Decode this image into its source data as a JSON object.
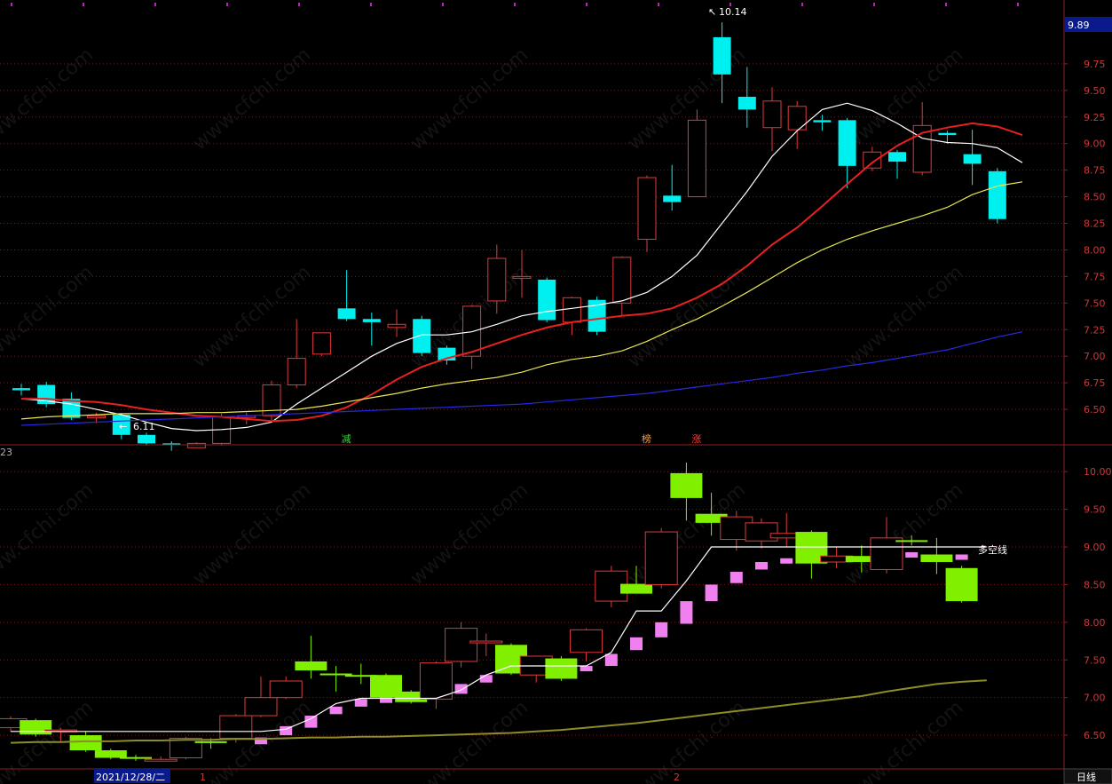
{
  "chart_data": [
    {
      "type": "candlestick",
      "panel": "top",
      "ylim": [
        6.2,
        10.25
      ],
      "yticks": [
        6.5,
        6.75,
        7.0,
        7.25,
        7.5,
        7.75,
        8.0,
        8.25,
        8.5,
        8.75,
        9.0,
        9.25,
        9.5,
        9.75
      ],
      "current_price_label": "9.89",
      "high_label": "10.14",
      "low_label": "6.11",
      "marker_labels": [
        {
          "text": "减",
          "index": 13,
          "color": "#3cd23c"
        },
        {
          "text": "榜",
          "index": 25,
          "color": "#e8a050"
        },
        {
          "text": "涨",
          "index": 27,
          "color": "#ff3c3c"
        }
      ],
      "left_axis_stub": "23",
      "candles": [
        {
          "o": 6.7,
          "h": 6.74,
          "l": 6.63,
          "c": 6.68
        },
        {
          "o": 6.73,
          "h": 6.76,
          "l": 6.52,
          "c": 6.55
        },
        {
          "o": 6.6,
          "h": 6.66,
          "l": 6.4,
          "c": 6.42
        },
        {
          "o": 6.42,
          "h": 6.47,
          "l": 6.37,
          "c": 6.44
        },
        {
          "o": 6.45,
          "h": 6.46,
          "l": 6.22,
          "c": 6.26
        },
        {
          "o": 6.26,
          "h": 6.28,
          "l": 6.16,
          "c": 6.18
        },
        {
          "o": 6.18,
          "h": 6.2,
          "l": 6.11,
          "c": 6.17
        },
        {
          "o": 6.14,
          "h": 6.19,
          "l": 6.14,
          "c": 6.18
        },
        {
          "o": 6.18,
          "h": 6.46,
          "l": 6.16,
          "c": 6.43
        },
        {
          "o": 6.44,
          "h": 6.47,
          "l": 6.36,
          "c": 6.44
        },
        {
          "o": 6.44,
          "h": 6.77,
          "l": 6.4,
          "c": 6.73
        },
        {
          "o": 6.73,
          "h": 7.35,
          "l": 6.7,
          "c": 6.98
        },
        {
          "o": 7.02,
          "h": 7.22,
          "l": 7.0,
          "c": 7.22
        },
        {
          "o": 7.45,
          "h": 7.81,
          "l": 7.33,
          "c": 7.35
        },
        {
          "o": 7.35,
          "h": 7.41,
          "l": 7.1,
          "c": 7.32
        },
        {
          "o": 7.27,
          "h": 7.44,
          "l": 7.18,
          "c": 7.3
        },
        {
          "o": 7.35,
          "h": 7.38,
          "l": 7.0,
          "c": 7.03
        },
        {
          "o": 7.08,
          "h": 7.1,
          "l": 6.92,
          "c": 6.96
        },
        {
          "o": 7.0,
          "h": 7.48,
          "l": 6.88,
          "c": 7.47
        },
        {
          "o": 7.52,
          "h": 8.05,
          "l": 7.4,
          "c": 7.92
        },
        {
          "o": 7.75,
          "h": 8.0,
          "l": 7.55,
          "c": 7.75
        },
        {
          "o": 7.72,
          "h": 7.74,
          "l": 7.32,
          "c": 7.34
        },
        {
          "o": 7.32,
          "h": 7.56,
          "l": 7.2,
          "c": 7.55
        },
        {
          "o": 7.53,
          "h": 7.56,
          "l": 7.2,
          "c": 7.23
        },
        {
          "o": 7.5,
          "h": 7.94,
          "l": 7.38,
          "c": 7.93
        },
        {
          "o": 8.1,
          "h": 8.7,
          "l": 7.98,
          "c": 8.68
        },
        {
          "o": 8.51,
          "h": 8.8,
          "l": 8.37,
          "c": 8.45
        },
        {
          "o": 8.5,
          "h": 9.32,
          "l": 8.5,
          "c": 9.22
        },
        {
          "o": 10.0,
          "h": 10.14,
          "l": 9.38,
          "c": 9.65
        },
        {
          "o": 9.44,
          "h": 9.72,
          "l": 9.15,
          "c": 9.32
        },
        {
          "o": 9.15,
          "h": 9.53,
          "l": 8.93,
          "c": 9.4
        },
        {
          "o": 9.13,
          "h": 9.4,
          "l": 8.95,
          "c": 9.35
        },
        {
          "o": 9.22,
          "h": 9.27,
          "l": 9.12,
          "c": 9.2
        },
        {
          "o": 9.22,
          "h": 9.24,
          "l": 8.58,
          "c": 8.79
        },
        {
          "o": 8.77,
          "h": 8.97,
          "l": 8.74,
          "c": 8.92
        },
        {
          "o": 8.92,
          "h": 8.94,
          "l": 8.67,
          "c": 8.83
        },
        {
          "o": 8.73,
          "h": 9.39,
          "l": 8.7,
          "c": 9.17
        },
        {
          "o": 9.1,
          "h": 9.12,
          "l": 9.0,
          "c": 9.08
        },
        {
          "o": 8.9,
          "h": 9.13,
          "l": 8.61,
          "c": 8.81
        },
        {
          "o": 8.74,
          "h": 8.77,
          "l": 8.25,
          "c": 8.29
        }
      ],
      "series": [
        {
          "color": "#ffffff",
          "values": [
            6.6,
            6.58,
            6.55,
            6.5,
            6.45,
            6.38,
            6.32,
            6.3,
            6.31,
            6.33,
            6.38,
            6.55,
            6.7,
            6.85,
            7.0,
            7.12,
            7.2,
            7.2,
            7.23,
            7.3,
            7.38,
            7.42,
            7.45,
            7.48,
            7.52,
            7.6,
            7.75,
            7.95,
            8.25,
            8.55,
            8.88,
            9.12,
            9.32,
            9.38,
            9.31,
            9.19,
            9.05,
            9.01,
            9.0,
            8.96,
            8.82
          ]
        },
        {
          "color": "#e82020",
          "values": [
            6.6,
            6.6,
            6.58,
            6.57,
            6.54,
            6.5,
            6.47,
            6.44,
            6.43,
            6.41,
            6.39,
            6.4,
            6.44,
            6.52,
            6.64,
            6.78,
            6.9,
            6.98,
            7.04,
            7.12,
            7.2,
            7.27,
            7.32,
            7.35,
            7.38,
            7.4,
            7.45,
            7.55,
            7.68,
            7.85,
            8.05,
            8.21,
            8.41,
            8.62,
            8.82,
            8.98,
            9.1,
            9.15,
            9.19,
            9.16,
            9.08
          ]
        },
        {
          "color": "#e8e850",
          "values": [
            6.41,
            6.43,
            6.44,
            6.45,
            6.46,
            6.46,
            6.46,
            6.47,
            6.47,
            6.48,
            6.49,
            6.5,
            6.53,
            6.57,
            6.61,
            6.65,
            6.7,
            6.74,
            6.77,
            6.8,
            6.85,
            6.92,
            6.97,
            7.0,
            7.05,
            7.14,
            7.25,
            7.35,
            7.47,
            7.6,
            7.74,
            7.88,
            8.0,
            8.1,
            8.18,
            8.25,
            8.32,
            8.4,
            8.52,
            8.6,
            8.64
          ]
        },
        {
          "color": "#2828e0",
          "values": [
            6.35,
            6.36,
            6.37,
            6.38,
            6.39,
            6.4,
            6.41,
            6.42,
            6.43,
            6.44,
            6.45,
            6.46,
            6.47,
            6.48,
            6.49,
            6.5,
            6.51,
            6.52,
            6.53,
            6.54,
            6.55,
            6.57,
            6.59,
            6.61,
            6.63,
            6.65,
            6.68,
            6.71,
            6.74,
            6.77,
            6.8,
            6.84,
            6.87,
            6.91,
            6.94,
            6.98,
            7.02,
            7.06,
            7.12,
            7.18,
            7.23
          ]
        }
      ]
    },
    {
      "type": "candlestick",
      "panel": "bottom",
      "ylim": [
        6.1,
        10.25
      ],
      "yticks": [
        6.5,
        7.0,
        7.5,
        8.0,
        8.5,
        9.0,
        9.5,
        10.0
      ],
      "line_label": "多空线",
      "candles": [
        {
          "o": 6.6,
          "h": 6.75,
          "l": 6.55,
          "c": 6.72
        },
        {
          "o": 6.7,
          "h": 6.72,
          "l": 6.48,
          "c": 6.51
        },
        {
          "o": 6.55,
          "h": 6.6,
          "l": 6.4,
          "c": 6.57
        },
        {
          "o": 6.5,
          "h": 6.55,
          "l": 6.28,
          "c": 6.3
        },
        {
          "o": 6.3,
          "h": 6.32,
          "l": 6.18,
          "c": 6.2
        },
        {
          "o": 6.21,
          "h": 6.24,
          "l": 6.16,
          "c": 6.19
        },
        {
          "o": 6.17,
          "h": 6.22,
          "l": 6.15,
          "c": 6.18
        },
        {
          "o": 6.2,
          "h": 6.48,
          "l": 6.18,
          "c": 6.46
        },
        {
          "o": 6.42,
          "h": 6.46,
          "l": 6.32,
          "c": 6.41
        },
        {
          "o": 6.46,
          "h": 6.78,
          "l": 6.4,
          "c": 6.76
        },
        {
          "o": 6.76,
          "h": 7.28,
          "l": 6.74,
          "c": 7.0
        },
        {
          "o": 7.0,
          "h": 7.28,
          "l": 6.98,
          "c": 7.22
        },
        {
          "o": 7.48,
          "h": 7.82,
          "l": 7.25,
          "c": 7.36
        },
        {
          "o": 7.32,
          "h": 7.42,
          "l": 7.08,
          "c": 7.3
        },
        {
          "o": 7.3,
          "h": 7.45,
          "l": 7.18,
          "c": 7.28
        },
        {
          "o": 7.3,
          "h": 7.32,
          "l": 6.98,
          "c": 7.0
        },
        {
          "o": 7.08,
          "h": 7.1,
          "l": 6.92,
          "c": 6.94
        },
        {
          "o": 6.98,
          "h": 7.48,
          "l": 6.85,
          "c": 7.46
        },
        {
          "o": 7.48,
          "h": 8.0,
          "l": 7.4,
          "c": 7.92
        },
        {
          "o": 7.75,
          "h": 7.85,
          "l": 7.55,
          "c": 7.75
        },
        {
          "o": 7.7,
          "h": 7.72,
          "l": 7.3,
          "c": 7.32
        },
        {
          "o": 7.3,
          "h": 7.55,
          "l": 7.2,
          "c": 7.55
        },
        {
          "o": 7.52,
          "h": 7.55,
          "l": 7.22,
          "c": 7.25
        },
        {
          "o": 7.6,
          "h": 7.92,
          "l": 7.48,
          "c": 7.9
        },
        {
          "o": 8.28,
          "h": 8.75,
          "l": 8.2,
          "c": 8.68
        },
        {
          "o": 8.51,
          "h": 8.75,
          "l": 8.38,
          "c": 8.38
        },
        {
          "o": 8.5,
          "h": 9.25,
          "l": 8.45,
          "c": 9.2
        },
        {
          "o": 9.98,
          "h": 10.12,
          "l": 9.35,
          "c": 9.65
        },
        {
          "o": 9.44,
          "h": 9.72,
          "l": 9.15,
          "c": 9.32
        },
        {
          "o": 9.1,
          "h": 9.48,
          "l": 8.95,
          "c": 9.4
        },
        {
          "o": 9.08,
          "h": 9.38,
          "l": 8.98,
          "c": 9.32
        },
        {
          "o": 9.12,
          "h": 9.45,
          "l": 9.0,
          "c": 9.18
        },
        {
          "o": 9.2,
          "h": 9.22,
          "l": 8.58,
          "c": 8.78
        },
        {
          "o": 8.8,
          "h": 9.0,
          "l": 8.72,
          "c": 8.88
        },
        {
          "o": 8.88,
          "h": 9.02,
          "l": 8.66,
          "c": 8.8
        },
        {
          "o": 8.7,
          "h": 9.4,
          "l": 8.65,
          "c": 9.12
        },
        {
          "o": 9.09,
          "h": 9.15,
          "l": 9.02,
          "c": 9.08
        },
        {
          "o": 8.9,
          "h": 9.12,
          "l": 8.64,
          "c": 8.8
        },
        {
          "o": 8.72,
          "h": 8.75,
          "l": 8.26,
          "c": 8.28
        }
      ],
      "pink_markers": [
        {
          "index": 10,
          "lo": 6.38,
          "hi": 6.47
        },
        {
          "index": 11,
          "lo": 6.5,
          "hi": 6.62
        },
        {
          "index": 12,
          "lo": 6.6,
          "hi": 6.76
        },
        {
          "index": 13,
          "lo": 6.78,
          "hi": 6.88
        },
        {
          "index": 14,
          "lo": 6.88,
          "hi": 6.98
        },
        {
          "index": 15,
          "lo": 6.94,
          "hi": 7.0
        },
        {
          "index": 18,
          "lo": 7.05,
          "hi": 7.18
        },
        {
          "index": 19,
          "lo": 7.2,
          "hi": 7.3
        },
        {
          "index": 23,
          "lo": 7.35,
          "hi": 7.42
        },
        {
          "index": 24,
          "lo": 7.42,
          "hi": 7.58
        },
        {
          "index": 25,
          "lo": 7.63,
          "hi": 7.8
        },
        {
          "index": 26,
          "lo": 7.8,
          "hi": 8.0
        },
        {
          "index": 27,
          "lo": 7.98,
          "hi": 8.28
        },
        {
          "index": 28,
          "lo": 8.28,
          "hi": 8.5
        },
        {
          "index": 29,
          "lo": 8.52,
          "hi": 8.67
        },
        {
          "index": 30,
          "lo": 8.7,
          "hi": 8.8
        },
        {
          "index": 31,
          "lo": 8.78,
          "hi": 8.85
        },
        {
          "index": 36,
          "lo": 8.88,
          "hi": 8.93
        },
        {
          "index": 38,
          "lo": 8.84,
          "hi": 8.9
        }
      ],
      "series": [
        {
          "color": "#ffffff",
          "values": [
            6.55,
            6.55,
            6.55,
            6.55,
            6.55,
            6.55,
            6.55,
            6.55,
            6.55,
            6.55,
            6.55,
            6.58,
            6.72,
            6.92,
            6.99,
            6.99,
            6.99,
            6.99,
            7.1,
            7.3,
            7.42,
            7.42,
            7.42,
            7.42,
            7.6,
            8.15,
            8.15,
            8.55,
            9.0,
            9.0,
            9.0,
            9.0,
            9.0,
            9.0,
            9.0,
            9.0,
            9.0,
            9.0,
            9.0,
            9.0
          ]
        },
        {
          "color": "#8c8c28",
          "values": [
            6.4,
            6.41,
            6.41,
            6.42,
            6.42,
            6.43,
            6.43,
            6.44,
            6.44,
            6.45,
            6.45,
            6.46,
            6.47,
            6.47,
            6.48,
            6.48,
            6.49,
            6.5,
            6.51,
            6.52,
            6.53,
            6.55,
            6.57,
            6.6,
            6.63,
            6.66,
            6.7,
            6.74,
            6.78,
            6.82,
            6.86,
            6.9,
            6.94,
            6.98,
            7.02,
            7.08,
            7.13,
            7.18,
            7.21,
            7.23
          ]
        }
      ]
    }
  ],
  "footer": {
    "date_label": "2021/12/28/二",
    "marker_1": "1",
    "marker_2": "2",
    "period_label": "日线"
  },
  "watermark": "www.cfchi.com"
}
